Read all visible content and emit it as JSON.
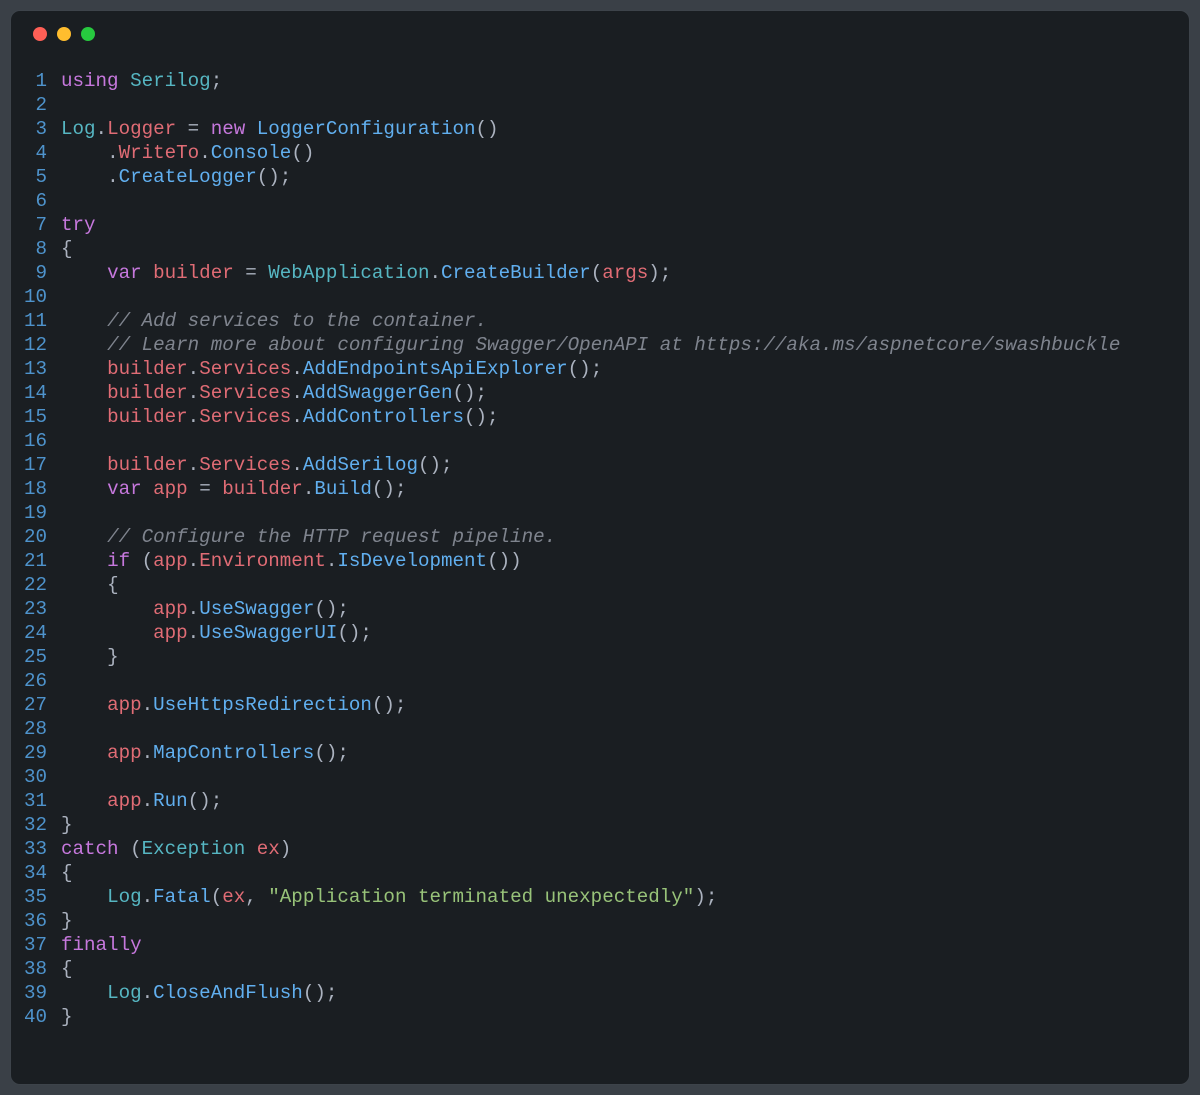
{
  "window": {
    "traffic_lights": [
      "close",
      "minimize",
      "zoom"
    ]
  },
  "tokens": {
    "kw_using": "using",
    "kw_new": "new",
    "kw_try": "try",
    "kw_var": "var",
    "kw_if": "if",
    "kw_catch": "catch",
    "kw_finally": "finally",
    "typ_Serilog": "Serilog",
    "typ_Log": "Log",
    "typ_LoggerConfiguration": "LoggerConfiguration",
    "typ_WebApplication": "WebApplication",
    "typ_Exception": "Exception",
    "prop_Logger": "Logger",
    "prop_WriteTo": "WriteTo",
    "prop_Services": "Services",
    "prop_Environment": "Environment",
    "var_builder": "builder",
    "var_app": "app",
    "var_ex": "ex",
    "var_args": "args",
    "fn_Console": "Console",
    "fn_CreateLogger": "CreateLogger",
    "fn_CreateBuilder": "CreateBuilder",
    "fn_AddEndpointsApiExplorer": "AddEndpointsApiExplorer",
    "fn_AddSwaggerGen": "AddSwaggerGen",
    "fn_AddControllers": "AddControllers",
    "fn_AddSerilog": "AddSerilog",
    "fn_Build": "Build",
    "fn_IsDevelopment": "IsDevelopment",
    "fn_UseSwagger": "UseSwagger",
    "fn_UseSwaggerUI": "UseSwaggerUI",
    "fn_UseHttpsRedirection": "UseHttpsRedirection",
    "fn_MapControllers": "MapControllers",
    "fn_Run": "Run",
    "fn_Fatal": "Fatal",
    "fn_CloseAndFlush": "CloseAndFlush",
    "cmt_11": "// Add services to the container.",
    "cmt_12": "// Learn more about configuring Swagger/OpenAPI at https://aka.ms/aspnetcore/swashbuckle",
    "cmt_20": "// Configure the HTTP request pipeline.",
    "str_35": "\"Application terminated unexpectedly\""
  },
  "line_numbers": [
    "1",
    "2",
    "3",
    "4",
    "5",
    "6",
    "7",
    "8",
    "9",
    "10",
    "11",
    "12",
    "13",
    "14",
    "15",
    "16",
    "17",
    "18",
    "19",
    "20",
    "21",
    "22",
    "23",
    "24",
    "25",
    "26",
    "27",
    "28",
    "29",
    "30",
    "31",
    "32",
    "33",
    "34",
    "35",
    "36",
    "37",
    "38",
    "39",
    "40"
  ]
}
